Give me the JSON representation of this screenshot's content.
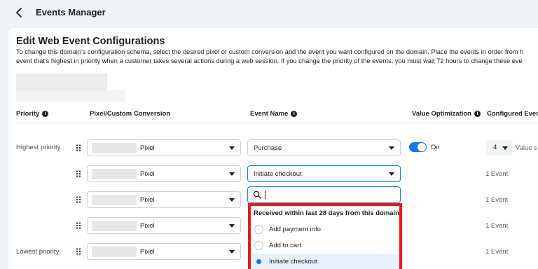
{
  "header": {
    "title": "Events Manager"
  },
  "card": {
    "title": "Edit Web Event Configurations",
    "description_lines": [
      "To change this domain's configuration schema, select the desired pixel or custom conversion and the event you want configured on the domain. Place the events in order from h",
      "event that's highest in priority when a customer takes several actions during a web session. If you change the priority of the events, you must wait 72 hours to change these eve"
    ]
  },
  "columns": {
    "priority": "Priority",
    "pixel": "Pixel/Custom Conversion",
    "event_name": "Event Name",
    "value_optimization": "Value Optimization",
    "configured_events": "Configured Event"
  },
  "rows": [
    {
      "priority_label": "Highest priority",
      "pixel": "Pixel",
      "event": "Purchase",
      "value_optimization": "On",
      "configured": "4",
      "configured_suffix": "Value s"
    },
    {
      "priority_label": "",
      "pixel": "Pixel",
      "event": "Initiate checkout",
      "configured": "1 Event"
    },
    {
      "priority_label": "",
      "pixel": "Pixel",
      "configured": "1 Event"
    },
    {
      "priority_label": "",
      "pixel": "Pixel",
      "configured": "1 Event"
    },
    {
      "priority_label": "Lowest priority",
      "pixel": "Pixel",
      "configured": "1 Event"
    }
  ],
  "event_dropdown": {
    "search_placeholder": "",
    "section_header": "Received within last 28 days from this domain",
    "options": [
      {
        "label": "Add payment info",
        "selected": false
      },
      {
        "label": "Add to cart",
        "selected": false
      },
      {
        "label": "Initiate checkout",
        "selected": true
      }
    ]
  },
  "colors": {
    "accent": "#1877f2",
    "highlight_border": "#e01e1e"
  },
  "icons": [
    "back-arrow-icon",
    "info-icon",
    "drag-handle-icon",
    "chevron-down-icon",
    "search-icon"
  ]
}
